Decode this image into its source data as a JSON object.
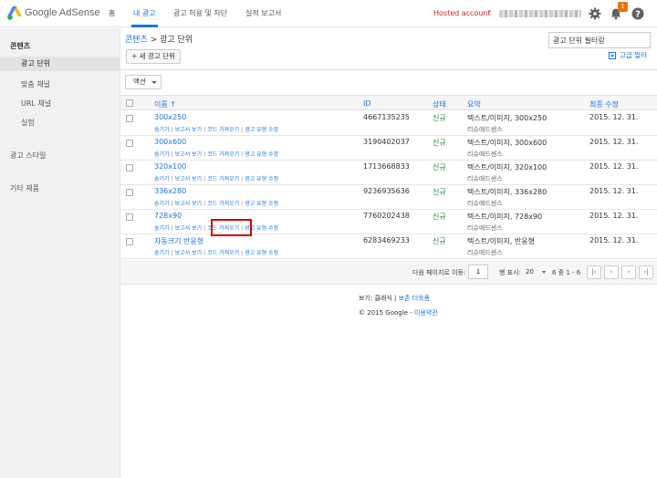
{
  "header": {
    "brand": "Google AdSense",
    "nav": [
      "홈",
      "내 광고",
      "광고 허용 및 차단",
      "실적 보고서"
    ],
    "active_nav": "내 광고",
    "hosted_account": "Hosted account",
    "help_marker": "?",
    "notification_count": "1",
    "colors": {
      "accent": "#1a73e8",
      "hosted": "#c5221f",
      "badge": "#e8710a"
    }
  },
  "sidebar": {
    "items": [
      {
        "label": "콘텐츠",
        "type": "section"
      },
      {
        "label": "광고 단위",
        "type": "item",
        "selected": true
      },
      {
        "label": "맞춤 채널",
        "type": "item"
      },
      {
        "label": "URL 채널",
        "type": "item"
      },
      {
        "label": "실험",
        "type": "item"
      },
      {
        "label": "광고 스타일",
        "type": "section-plain"
      },
      {
        "label": "기타 제품",
        "type": "section-plain"
      }
    ]
  },
  "breadcrumb": {
    "root": "콘텐츠",
    "sep": " > ",
    "current": "광고 단위"
  },
  "filter": {
    "value": "광고 단위 필터링"
  },
  "new_button": "+ 새 광고 단위",
  "advanced_filter": "고급 필터",
  "action_button": "액션",
  "table": {
    "columns": {
      "name": "이름 ↑",
      "id": "ID",
      "status": "상태",
      "summary": "요약",
      "modified": "최종 수정"
    },
    "row_links": [
      "숨기기",
      "보고서 보기",
      "코드 가져오기",
      "광고 유형 수정"
    ],
    "rows": [
      {
        "name": "300x250",
        "id": "4667135235",
        "status": "신규",
        "summary": "텍스트/이미지, 300x250",
        "summary2": "",
        "modified": "2015. 12. 31."
      },
      {
        "name": "300x600",
        "id": "3190402037",
        "status": "신규",
        "summary": "텍스트/이미지, 300x600",
        "summary2": "",
        "modified": "2015. 12. 31."
      },
      {
        "name": "320x100",
        "id": "1713668833",
        "status": "신규",
        "summary": "텍스트/이미지, 320x100",
        "summary2": "",
        "modified": "2015. 12. 31."
      },
      {
        "name": "336x280",
        "id": "9236935636",
        "status": "신규",
        "summary": "텍스트/이미지, 336x280",
        "summary2": "",
        "modified": "2015. 12. 31."
      },
      {
        "name": "728x90",
        "id": "7760202438",
        "status": "신규",
        "summary": "텍스트/이미지, 728x90",
        "summary2": "",
        "modified": "2015. 12. 31."
      },
      {
        "name": "자동크기 반응형",
        "id": "6283469233",
        "status": "신규",
        "summary": "텍스트/이미지, 반응형",
        "summary2": "",
        "modified": "2015. 12. 31."
      }
    ],
    "summary_sub": "리슈애드센스"
  },
  "pager": {
    "goto_label": "다음 페이지로 이동:",
    "page_value": "1",
    "rows_label": "행 표시:",
    "rows_value": "20",
    "range": "6 중 1 - 6",
    "buttons": [
      "|‹",
      "‹",
      "›",
      "›|"
    ]
  },
  "footer": {
    "view_label": "보기: ",
    "classic": "클래식",
    "sep": " | ",
    "new_view": "보존 더욱폼",
    "copyright": "© 2015 Google - ",
    "terms": "이용약관"
  }
}
